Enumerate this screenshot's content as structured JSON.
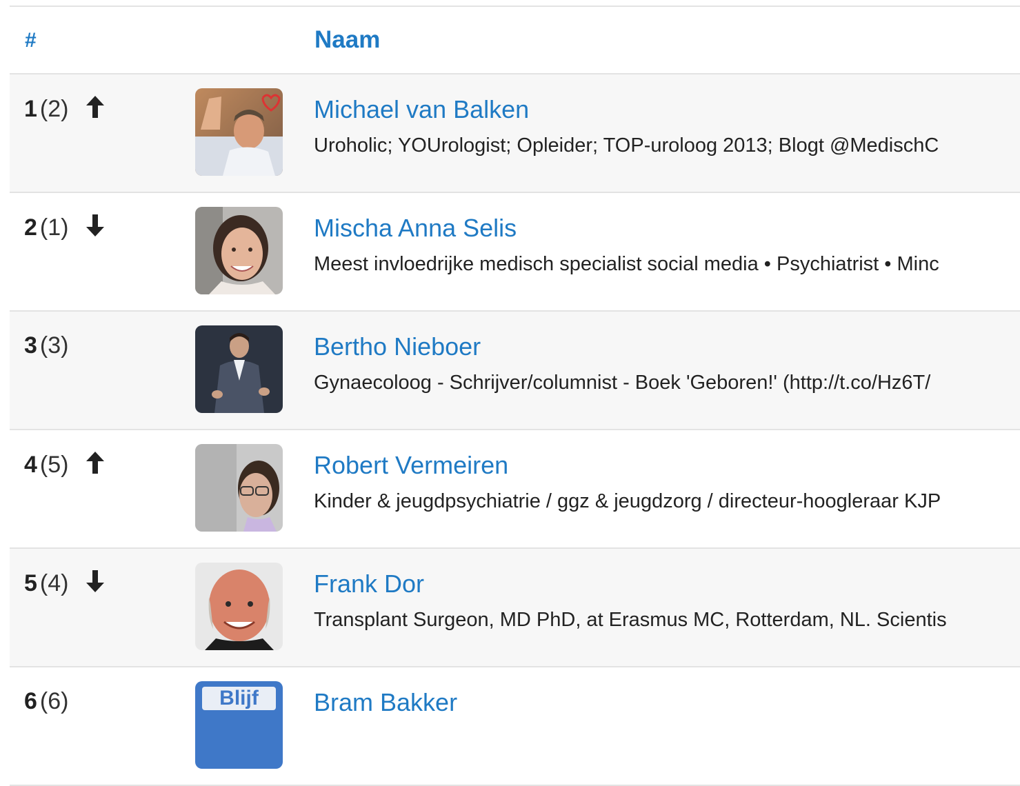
{
  "table": {
    "headers": {
      "rank": "#",
      "name": "Naam"
    },
    "rows": [
      {
        "rank": "1",
        "prev": "(2)",
        "trend": "up",
        "name": "Michael van Balken",
        "bio": "Uroholic; YOUrologist; Opleider; TOP-uroloog 2013; Blogt @MedischC",
        "avatar": "waving-man-photo"
      },
      {
        "rank": "2",
        "prev": "(1)",
        "trend": "down",
        "name": "Mischa Anna Selis",
        "bio": "Meest invloedrijke medisch specialist social media • Psychiatrist • Minc",
        "avatar": "smiling-woman-photo"
      },
      {
        "rank": "3",
        "prev": "(3)",
        "trend": "none",
        "name": "Bertho Nieboer",
        "bio": "Gynaecoloog - Schrijver/columnist - Boek 'Geboren!' (http://t.co/Hz6T/",
        "avatar": "man-in-suit-photo"
      },
      {
        "rank": "4",
        "prev": "(5)",
        "trend": "up",
        "name": "Robert Vermeiren",
        "bio": "Kinder & jeugdpsychiatrie / ggz & jeugdzorg / directeur-hoogleraar KJP",
        "avatar": "man-with-glasses-photo"
      },
      {
        "rank": "5",
        "prev": "(4)",
        "trend": "down",
        "name": "Frank Dor",
        "bio": "Transplant Surgeon, MD PhD, at Erasmus MC, Rotterdam, NL. Scientis",
        "avatar": "bald-man-photo"
      },
      {
        "rank": "6",
        "prev": "(6)",
        "trend": "none",
        "name": "Bram Bakker",
        "bio": "",
        "avatar": "blijf-logo",
        "avatar_text": "Blijf"
      }
    ]
  },
  "colors": {
    "link": "#1f7ac4",
    "border": "#e3e3e3",
    "stripe": "#f7f7f7",
    "text": "#222222"
  },
  "icons": {
    "up": "arrow-up-icon",
    "down": "arrow-down-icon"
  }
}
